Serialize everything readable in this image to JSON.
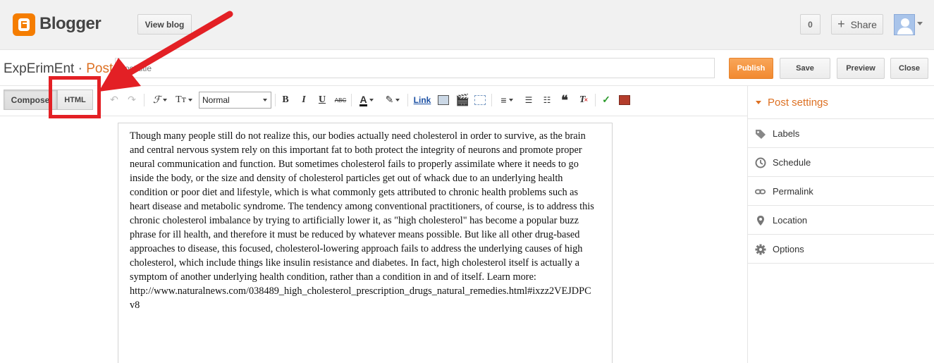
{
  "header": {
    "brand": "Blogger",
    "view_blog": "View blog",
    "count": "0",
    "share": "Share"
  },
  "titlebar": {
    "blog_name": "ExpErimEnt",
    "separator": " · ",
    "section": "Post",
    "title_placeholder": "Post title",
    "publish": "Publish",
    "save": "Save",
    "preview": "Preview",
    "close": "Close"
  },
  "toolbar": {
    "compose": "Compose",
    "html": "HTML",
    "format_value": "Normal",
    "link": "Link"
  },
  "editor": {
    "body": "Though many people still do not realize this, our bodies actually need cholesterol in order to survive, as the brain and central nervous system rely on this important fat to both protect the integrity of neurons and promote proper neural communication and function. But sometimes cholesterol fails to properly assimilate where it needs to go inside the body, or the size and density of cholesterol particles get out of whack due to an underlying health condition or poor diet and lifestyle, which is what commonly gets attributed to chronic health problems such as heart disease and metabolic syndrome. The tendency among conventional practitioners, of course, is to address this chronic cholesterol imbalance by trying to artificially lower it, as \"high cholesterol\" has become a popular buzz phrase for ill health, and therefore it must be reduced by whatever means possible. But like all other drug-based approaches to disease, this focused, cholesterol-lowering approach fails to address the underlying causes of high cholesterol, which include things like insulin resistance and diabetes. In fact, high cholesterol itself is actually a symptom of another underlying health condition, rather than a condition in and of itself. Learn more: http://www.naturalnews.com/038489_high_cholesterol_prescription_drugs_natural_remedies.html#ixzz2VEJDPCv8"
  },
  "sidebar": {
    "title": "Post settings",
    "items": [
      {
        "label": "Labels",
        "icon": "tag-icon"
      },
      {
        "label": "Schedule",
        "icon": "clock-icon"
      },
      {
        "label": "Permalink",
        "icon": "link-icon"
      },
      {
        "label": "Location",
        "icon": "pin-icon"
      },
      {
        "label": "Options",
        "icon": "gear-icon"
      }
    ]
  },
  "colors": {
    "accent": "#dd7022",
    "publish": "#f28a30",
    "annotation": "#e32025"
  }
}
